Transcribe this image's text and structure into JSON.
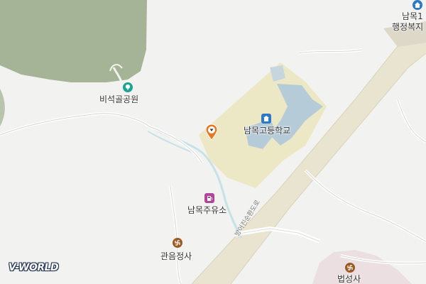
{
  "map": {
    "labels": {
      "park": "비석골공원",
      "school": "남목고등학교",
      "gas_station": "남목주유소",
      "temple1": "관음정사",
      "temple2": "법성사",
      "office_line1": "남목1",
      "office_line2": "행정복지"
    },
    "road_name": "방어진순환도로",
    "branding": "V-WORLD",
    "icons": {
      "park": "tree-icon",
      "school": "school-icon",
      "gas_station": "fuel-icon",
      "temple": "temple-swastika-icon",
      "office": "government-office-icon",
      "marker": "location-pin-icon"
    },
    "colors": {
      "forest": "#a5b396",
      "road": "#e9e4cf",
      "school_area": "#ece8c5",
      "building": "#b6cbd8",
      "water": "#c5e2e8",
      "park_icon": "#18a592",
      "school_icon": "#2f78c4",
      "gas_icon": "#b1459a",
      "temple_icon": "#9a5a26",
      "marker": "#e8781f"
    }
  }
}
